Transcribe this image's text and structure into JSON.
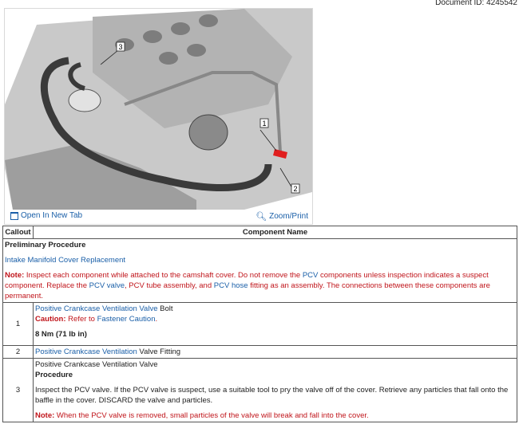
{
  "document_id": "Document ID: 4245542",
  "figure": {
    "callouts": [
      "1",
      "2",
      "3"
    ],
    "open_tab": "Open In New Tab",
    "zoom_print": "Zoom/Print"
  },
  "table": {
    "headers": [
      "Callout",
      "Component Name"
    ],
    "preliminary": {
      "title": "Preliminary Procedure",
      "link": "Intake Manifold Cover Replacement",
      "note_label": "Note:",
      "note_parts": [
        " Inspect each component while attached to the camshaft cover. Do not remove the ",
        "PCV",
        " components unless inspection indicates a suspect component. Replace the ",
        "PCV valve",
        ", ",
        "PCV tube assembly",
        ", and ",
        "PCV hose",
        " fitting as an assembly. The connections between these components are permanent."
      ]
    },
    "rows": [
      {
        "num": "1",
        "name_link": "Positive Crankcase Ventilation Valve",
        "name_rest": " Bolt",
        "caution_label": "Caution:",
        "caution_text": " Refer to ",
        "caution_link": "Fastener Caution",
        "caution_end": ".",
        "torque": "8 Nm (71 lb in)"
      },
      {
        "num": "2",
        "name_link": "Positive Crankcase Ventilation",
        "name_rest": " Valve Fitting"
      },
      {
        "num": "3",
        "name": "Positive Crankcase Ventilation Valve",
        "procedure": "Procedure",
        "step": "Inspect the PCV valve. If the PCV valve is suspect, use a suitable tool to pry the valve off of the cover. Retrieve any particles that fall onto the baffle in the cover. DISCARD the valve and particles.",
        "note_label": "Note:",
        "note_text": " When the PCV valve is removed, small particles of the valve will break and fall into the cover."
      }
    ]
  }
}
